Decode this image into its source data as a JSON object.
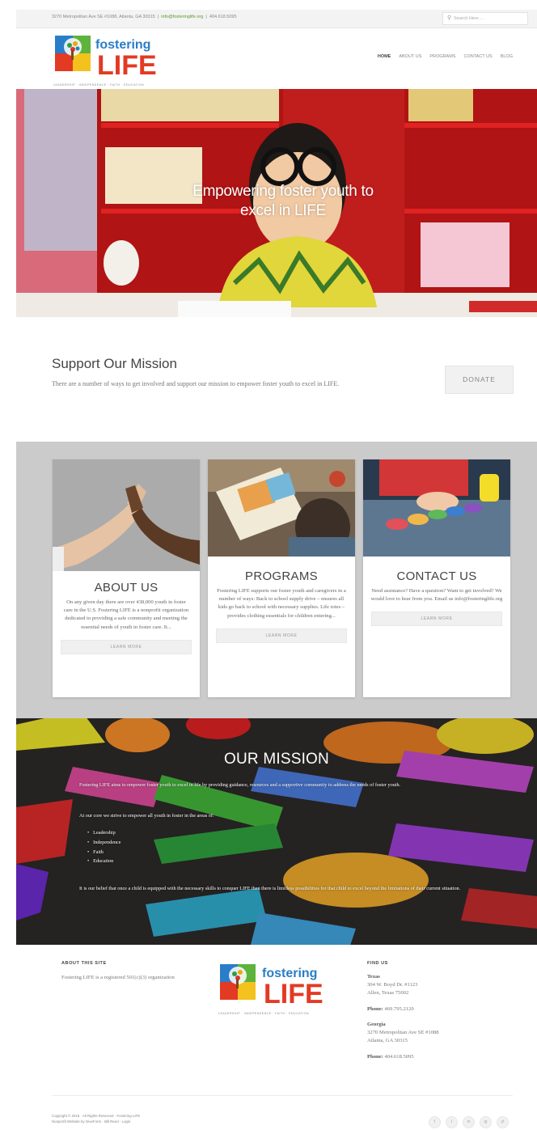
{
  "topbar": {
    "address": "3270 Metropolitan Ave SE #1088, Atlanta, GA 30315",
    "email": "info@fosteringlife.org",
    "phone": "404.618.5095",
    "search_placeholder": "Search Here ..."
  },
  "logo": {
    "word1": "fostering",
    "word2": "LIFE",
    "tagline": "LEADERSHIP · INDEPENDENCE · FAITH · EDUCATION"
  },
  "nav": [
    "HOME",
    "ABOUT US",
    "PROGRAMS",
    "CONTACT US",
    "BLOG"
  ],
  "hero": {
    "title_line1": "Empowering foster youth to",
    "title_line2": "excel in LIFE"
  },
  "support": {
    "title": "Support Our Mission",
    "text": "There are a number of ways to get involved and support our mission to empower foster youth to excel in LIFE.",
    "button": "DONATE"
  },
  "cards": [
    {
      "title": "ABOUT US",
      "text": "On any given day there are over 438,000 youth in foster care in the U.S. Fostering LIFE is a nonprofit organization dedicated to providing a safe community and meeting the essential needs of youth in foster care. It...",
      "button": "LEARN MORE"
    },
    {
      "title": "PROGRAMS",
      "text": "Fostering LIFE supports our foster youth and caregivers in a number of ways: Back to school supply drive – ensures all kids go back to school with necessary supplies. Life totes – provides clothing essentials for children entering...",
      "button": "LEARN MORE"
    },
    {
      "title": "CONTACT US",
      "text": "Need assistance? Have a question? Want to get involved? We would love to hear from you. Email us info@fosteringlife.org",
      "button": "LEARN MORE"
    }
  ],
  "mission": {
    "title": "OUR MISSION",
    "p1": "Fostering LIFE aims to empower foster youth to excel in life by providing guidance, resources and a supportive community to address the needs of foster youth.",
    "p2": "At our core we strive to empower all youth in foster in the areas of:",
    "items": [
      "Leadership",
      "Independence",
      "Faith",
      "Education"
    ],
    "p3": "It is our belief that once a child is equipped with the necessary skills to conquer LIFE then there is limitless possibilities for that child to excel beyond the limitations of their current situation."
  },
  "footer": {
    "about_head": "ABOUT THIS SITE",
    "about_text": "Fostering LIFE is a registered 501(c)(3) organization",
    "find_head": "FIND US",
    "texas_label": "Texas",
    "texas_addr1": "304 W. Boyd Dr. #1123",
    "texas_addr2": "Allen, Texas 75002",
    "texas_phone_label": "Phone:",
    "texas_phone": "469.795.2120",
    "georgia_label": "Georgia",
    "georgia_addr1": "3270 Metropolitan Ave SE #1088",
    "georgia_addr2": "Atlanta, GA 30315",
    "georgia_phone_label": "Phone:",
    "georgia_phone": "404.618.5095",
    "copyright_line1": "Copyright © 2019 · All Rights Reserved · Fostering LIFE",
    "copyright_line2": "Nonprofit Website by GiveForm · Bill Reed · Login",
    "social": [
      "f",
      "t",
      "in",
      "ig",
      "yt"
    ]
  },
  "colors": {
    "accent_green": "#5a9a2a",
    "hero_red": "#c21b1b",
    "cards_bg": "#cbcbcb",
    "mission_bg": "#2d2a2a"
  }
}
